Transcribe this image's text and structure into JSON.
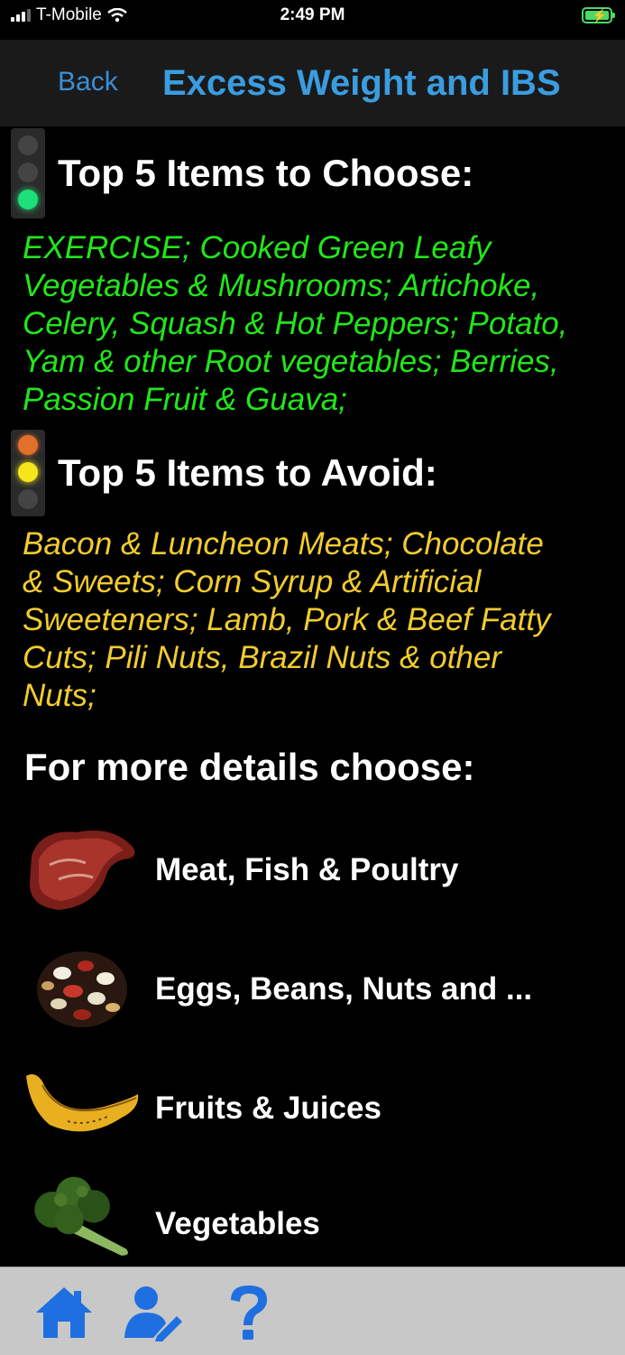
{
  "status_bar": {
    "carrier": "T-Mobile",
    "time": "2:49 PM",
    "battery_color": "#4cd964"
  },
  "nav": {
    "back_label": "Back",
    "title": "Excess Weight and IBS",
    "accent": "#3a9de0"
  },
  "choose": {
    "heading": "Top 5 Items to Choose:",
    "icon": "traffic-light-green-icon",
    "lines": [
      "EXERCISE; Cooked Green Leafy",
      "Vegetables & Mushrooms; Artichoke,",
      "Celery, Squash & Hot Peppers; Potato,",
      "Yam & other Root vegetables; Berries,",
      "Passion Fruit & Guava;"
    ],
    "color": "#22e61a"
  },
  "avoid": {
    "heading": "Top 5 Items to Avoid:",
    "icon": "traffic-light-yellow-icon",
    "lines": [
      "Bacon & Luncheon Meats;  Chocolate",
      "& Sweets;  Corn Syrup & Artificial",
      "Sweeteners; Lamb, Pork & Beef Fatty",
      "Cuts; Pili Nuts, Brazil Nuts & other",
      "Nuts;"
    ],
    "color": "#f2cc2e"
  },
  "details": {
    "heading": "For more details choose:",
    "categories": [
      {
        "label": "Meat, Fish & Poultry",
        "icon": "steak-icon"
      },
      {
        "label": "Eggs, Beans, Nuts and ...",
        "icon": "beans-icon"
      },
      {
        "label": "Fruits & Juices",
        "icon": "banana-icon"
      },
      {
        "label": "Vegetables",
        "icon": "broccoli-icon"
      }
    ]
  },
  "tabbar": {
    "tabs": [
      {
        "icon": "home-icon"
      },
      {
        "icon": "profile-edit-icon"
      },
      {
        "icon": "help-icon"
      }
    ],
    "icon_color": "#1f6fe0"
  }
}
